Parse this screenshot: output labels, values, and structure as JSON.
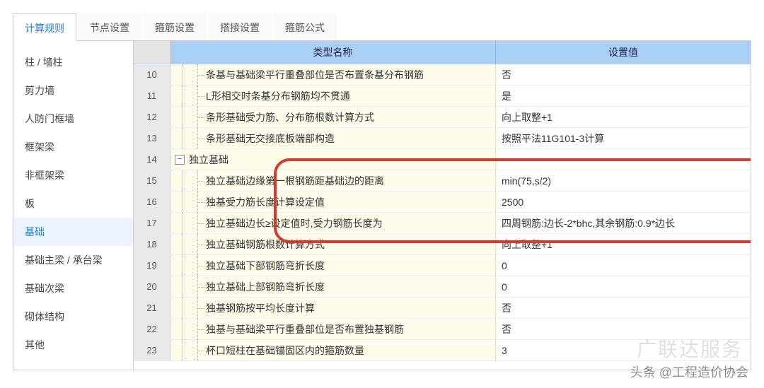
{
  "tabs": {
    "items": [
      "计算规则",
      "节点设置",
      "箍筋设置",
      "搭接设置",
      "箍筋公式"
    ],
    "active_index": 0
  },
  "sidebar": {
    "items": [
      "柱 / 墙柱",
      "剪力墙",
      "人防门框墙",
      "框架梁",
      "非框架梁",
      "板",
      "基础",
      "基础主梁 / 承台梁",
      "基础次梁",
      "砌体结构",
      "其他"
    ],
    "selected_index": 6
  },
  "grid": {
    "headers": {
      "name": "类型名称",
      "value": "设置值"
    },
    "rows": [
      {
        "no": "10",
        "indent": 2,
        "name": "条基与基础梁平行重叠部位是否布置条基分布钢筋",
        "value": "否"
      },
      {
        "no": "11",
        "indent": 2,
        "name": "L形相交时条基分布钢筋均不贯通",
        "value": "是"
      },
      {
        "no": "12",
        "indent": 2,
        "name": "条形基础受力筋、分布筋根数计算方式",
        "value": "向上取整+1"
      },
      {
        "no": "13",
        "indent": 2,
        "name": "条形基础无交接底板端部构造",
        "value": "按照平法11G101-3计算"
      },
      {
        "no": "14",
        "indent": 0,
        "group": true,
        "expander": "−",
        "name": "独立基础",
        "value": ""
      },
      {
        "no": "15",
        "indent": 2,
        "name": "独立基础边缘第一根钢筋距基础边的距离",
        "value": "min(75,s/2)"
      },
      {
        "no": "16",
        "indent": 2,
        "name": "独基受力筋长度计算设定值",
        "value": "2500"
      },
      {
        "no": "17",
        "indent": 2,
        "name": "独立基础边长≥设定值时,受力钢筋长度为",
        "value": "四周钢筋:边长-2*bhc,其余钢筋:0.9*边长"
      },
      {
        "no": "18",
        "indent": 2,
        "name": "独立基础钢筋根数计算方式",
        "value": "向上取整+1"
      },
      {
        "no": "19",
        "indent": 2,
        "name": "独立基础下部钢筋弯折长度",
        "value": "0"
      },
      {
        "no": "20",
        "indent": 2,
        "name": "独立基础上部钢筋弯折长度",
        "value": "0"
      },
      {
        "no": "21",
        "indent": 2,
        "name": "独基钢筋按平均长度计算",
        "value": "否"
      },
      {
        "no": "22",
        "indent": 2,
        "name": "独基与基础梁平行重叠部位是否布置独基钢筋",
        "value": "否"
      },
      {
        "no": "23",
        "indent": 2,
        "name": "杯口短柱在基础锚固区内的箍筋数量",
        "value": "3"
      }
    ]
  },
  "overlay": {
    "brand": "广联达服务",
    "attribution": "头条 @工程造价协会"
  }
}
